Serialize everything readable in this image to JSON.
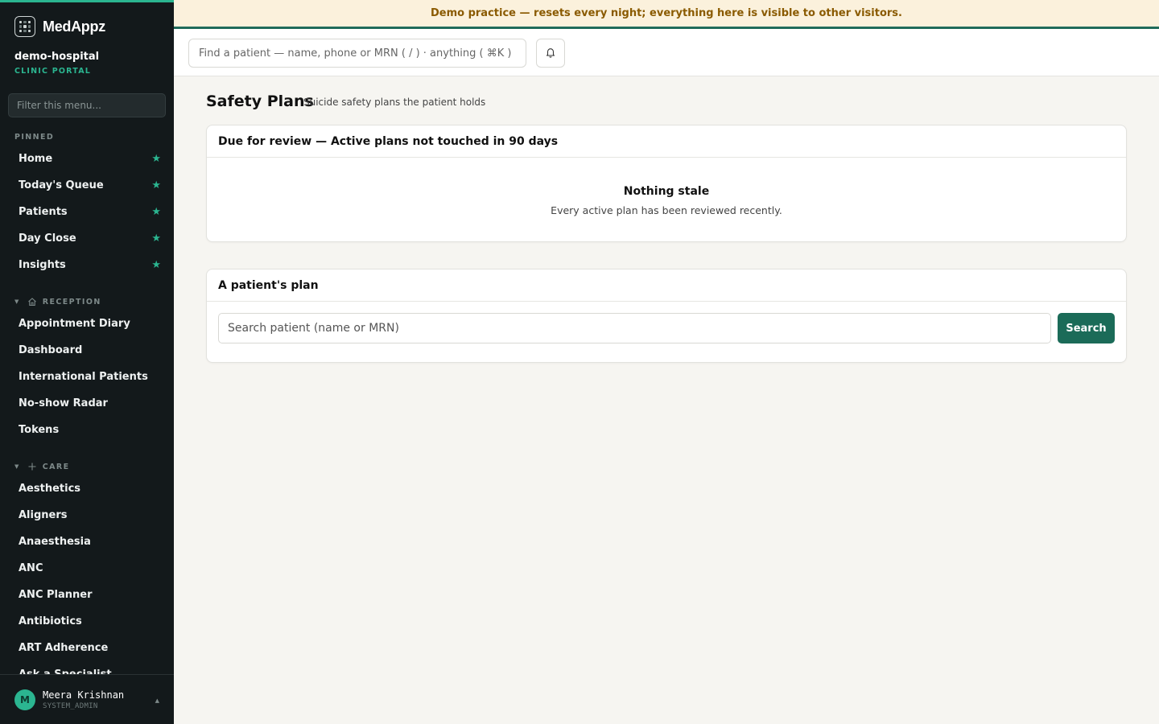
{
  "brand": {
    "name": "MedAppz"
  },
  "org": {
    "name": "demo-hospital",
    "portal": "CLINIC PORTAL"
  },
  "sidebar": {
    "filter_placeholder": "Filter this menu...",
    "pinned_label": "PINNED",
    "pinned": [
      {
        "label": "Home"
      },
      {
        "label": "Today's Queue"
      },
      {
        "label": "Patients"
      },
      {
        "label": "Day Close"
      },
      {
        "label": "Insights"
      }
    ],
    "reception_label": "RECEPTION",
    "reception": [
      {
        "label": "Appointment Diary"
      },
      {
        "label": "Dashboard"
      },
      {
        "label": "International Patients"
      },
      {
        "label": "No-show Radar"
      },
      {
        "label": "Tokens"
      }
    ],
    "care_label": "CARE",
    "care": [
      {
        "label": "Aesthetics"
      },
      {
        "label": "Aligners"
      },
      {
        "label": "Anaesthesia"
      },
      {
        "label": "ANC"
      },
      {
        "label": "ANC Planner"
      },
      {
        "label": "Antibiotics"
      },
      {
        "label": "ART Adherence"
      },
      {
        "label": "Ask a Specialist"
      }
    ]
  },
  "user": {
    "initial": "M",
    "name": "Meera Krishnan",
    "role": "SYSTEM_ADMIN"
  },
  "banner": {
    "text": "Demo practice — resets every night; everything here is visible to other visitors."
  },
  "topbar": {
    "search_placeholder": "Find a patient — name, phone or MRN ( / ) · anything ( ⌘K )"
  },
  "page": {
    "title": "Safety Plans",
    "subtitle": "Suicide safety plans the patient holds"
  },
  "review_card": {
    "title": "Due for review — Active plans not touched in 90 days",
    "empty_title": "Nothing stale",
    "empty_text": "Every active plan has been reviewed recently."
  },
  "plan_card": {
    "title": "A patient's plan",
    "search_placeholder": "Search patient (name or MRN)",
    "search_button": "Search"
  },
  "colors": {
    "accent": "#2bb590",
    "sidebar_bg": "#13191b",
    "primary_button": "#1b6b58",
    "banner_bg": "#fbf1dc",
    "banner_text": "#8a5a00"
  }
}
